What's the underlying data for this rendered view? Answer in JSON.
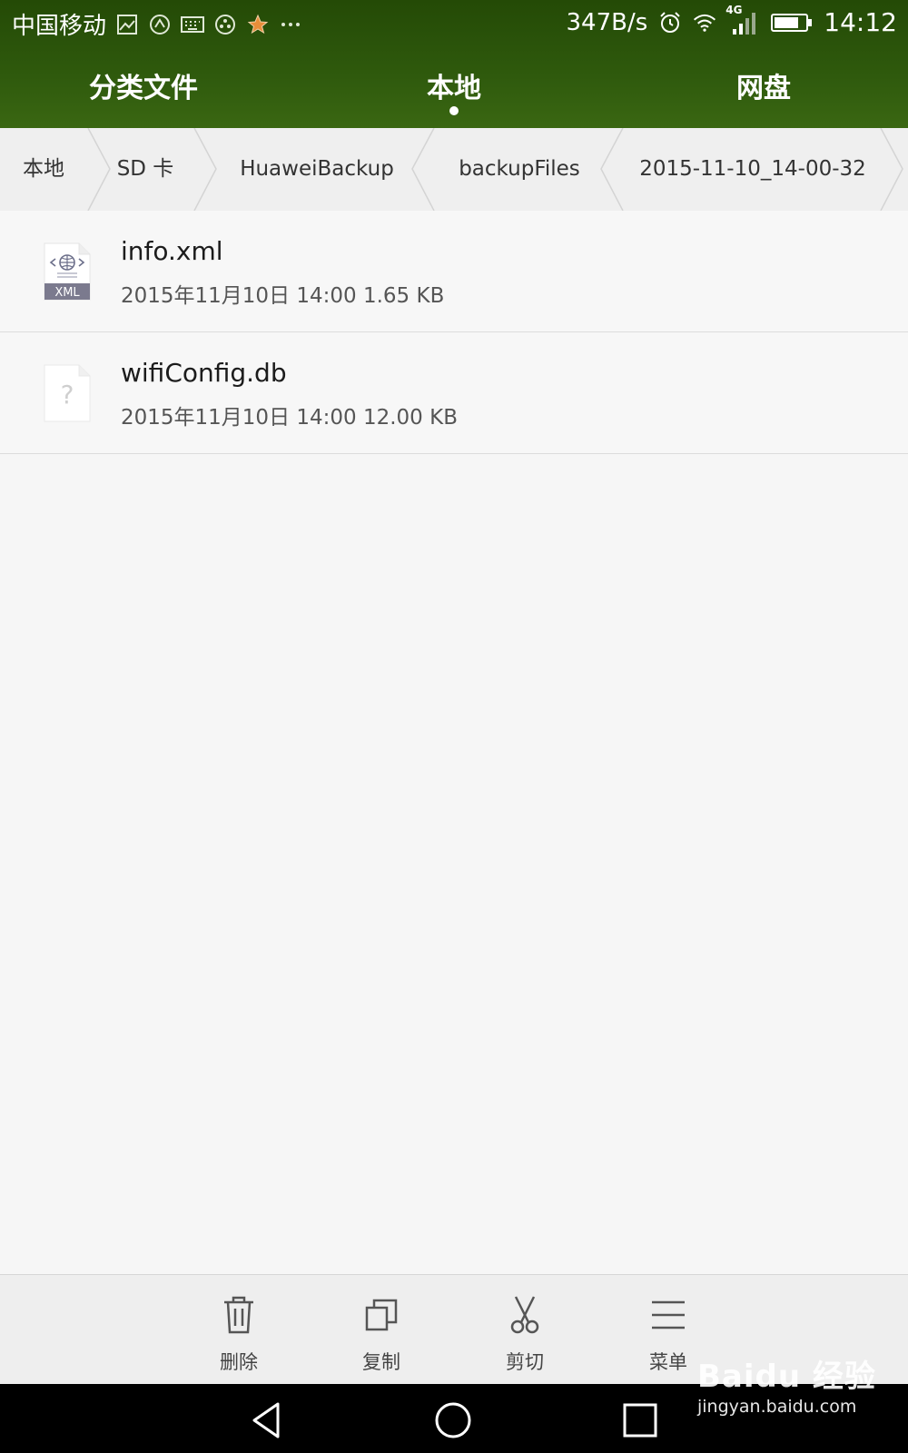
{
  "status_bar": {
    "carrier": "中国移动",
    "net_speed": "347B/s",
    "network_type": "4G",
    "time": "14:12",
    "left_icons": [
      "gallery-icon",
      "app-icon",
      "keyboard-icon",
      "app-icon",
      "star-icon",
      "more-icon"
    ],
    "right_icons": [
      "alarm-icon",
      "wifi-icon",
      "signal-icon",
      "battery-icon"
    ]
  },
  "tabs": [
    {
      "label": "分类文件",
      "active": false
    },
    {
      "label": "本地",
      "active": true
    },
    {
      "label": "网盘",
      "active": false
    }
  ],
  "breadcrumb": [
    "本地",
    "SD 卡",
    "HuaweiBackup",
    "backupFiles",
    "2015-11-10_14-00-32"
  ],
  "files": [
    {
      "name": "info.xml",
      "meta": "2015年11月10日 14:00 1.65 KB",
      "icon": "xml-file-icon",
      "icon_badge": "XML"
    },
    {
      "name": "wifiConfig.db",
      "meta": "2015年11月10日 14:00 12.00 KB",
      "icon": "unknown-file-icon",
      "icon_glyph": "?"
    }
  ],
  "toolbar": [
    {
      "label": "删除",
      "icon": "trash-icon"
    },
    {
      "label": "复制",
      "icon": "copy-icon"
    },
    {
      "label": "剪切",
      "icon": "scissors-icon"
    },
    {
      "label": "菜单",
      "icon": "menu-icon"
    }
  ],
  "nav_bar": [
    "back-icon",
    "home-icon",
    "recents-icon"
  ],
  "watermark": {
    "brand": "Baidu 经验",
    "url": "jingyan.baidu.com"
  },
  "colors": {
    "header": "#2f5a0d",
    "background": "#f6f6f6",
    "toolbar": "#eeeeee"
  }
}
